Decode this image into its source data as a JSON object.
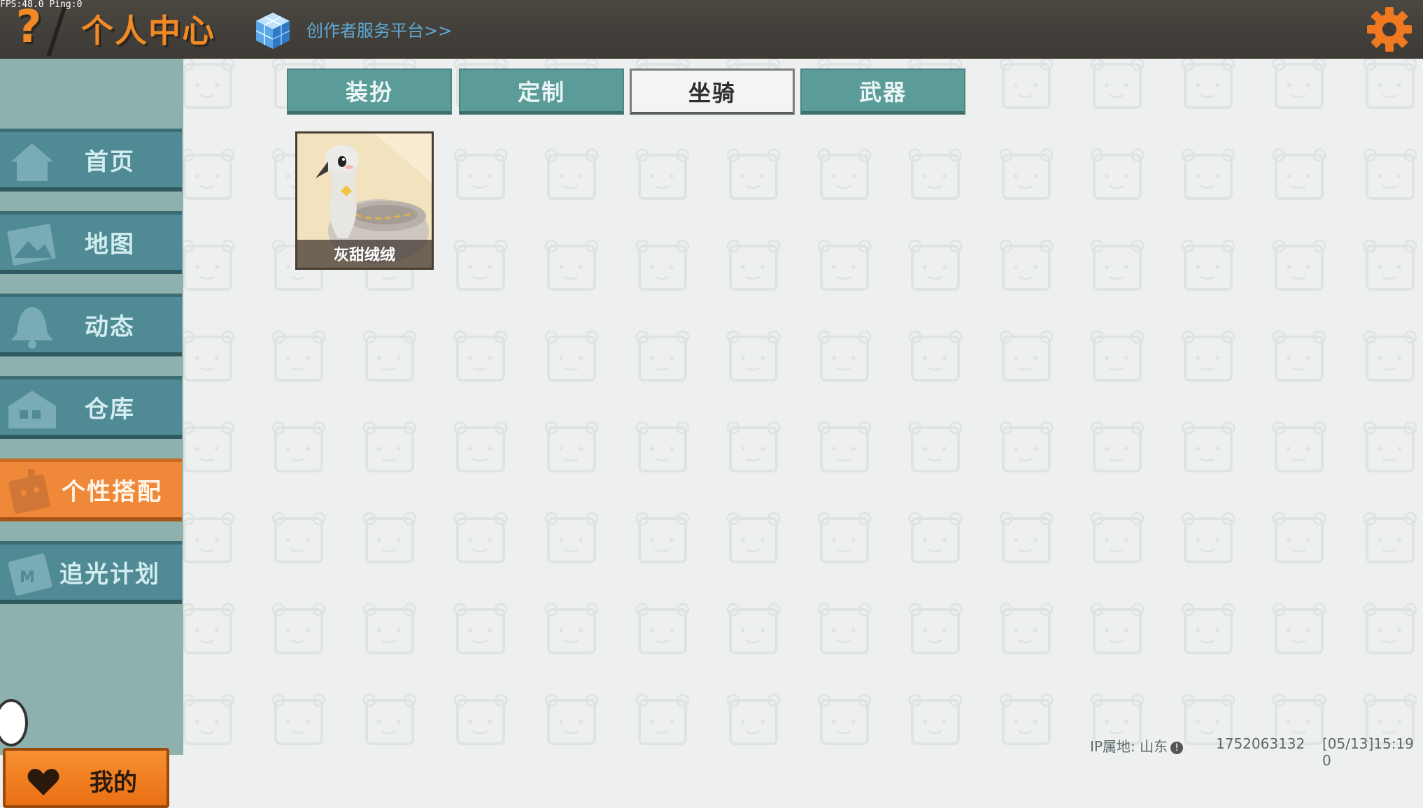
{
  "debug": {
    "fps_text": "FPS:48.0  Ping:0"
  },
  "header": {
    "title": "个人中心",
    "creator_link": "创作者服务平台>>",
    "help_icon": "?",
    "accent_color": "#f18a24"
  },
  "sidebar": {
    "items": [
      {
        "label": "首页",
        "icon": "home-icon"
      },
      {
        "label": "地图",
        "icon": "map-icon"
      },
      {
        "label": "动态",
        "icon": "bell-icon"
      },
      {
        "label": "仓库",
        "icon": "warehouse-icon"
      },
      {
        "label": "个性搭配",
        "icon": "avatar-icon",
        "active": true
      },
      {
        "label": "追光计划",
        "icon": "plan-icon"
      }
    ],
    "mine_button": "我的"
  },
  "main": {
    "tabs": [
      {
        "label": "装扮"
      },
      {
        "label": "定制"
      },
      {
        "label": "坐骑",
        "active": true
      },
      {
        "label": "武器"
      }
    ],
    "items": [
      {
        "name": "灰甜绒绒",
        "icon": "goose-mount-icon"
      }
    ]
  },
  "footer": {
    "ip_location": "IP属地: 山东",
    "uid": "1752063132",
    "timestamp": "[05/13]15:19 0"
  }
}
